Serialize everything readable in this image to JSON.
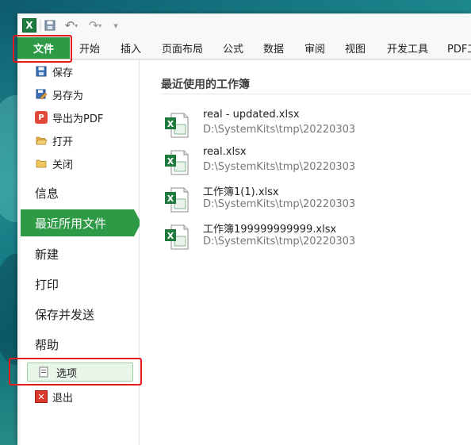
{
  "qat": {
    "app_icon_text": "X",
    "icons": [
      "excel-logo-icon",
      "save-icon",
      "undo-icon",
      "redo-icon",
      "customize-icon"
    ]
  },
  "ribbon": {
    "file_tab": "文件",
    "tabs": [
      "开始",
      "插入",
      "页面布局",
      "公式",
      "数据",
      "审阅",
      "视图",
      "开发工具",
      "PDF工具"
    ]
  },
  "backstage": {
    "commands": [
      {
        "label": "保存",
        "icon": "save-icon"
      },
      {
        "label": "另存为",
        "icon": "save-as-icon"
      },
      {
        "label": "导出为PDF",
        "icon": "pdf-icon"
      },
      {
        "label": "打开",
        "icon": "folder-open-icon"
      },
      {
        "label": "关闭",
        "icon": "folder-close-icon"
      }
    ],
    "nav": [
      "信息",
      "最近所用文件",
      "新建",
      "打印",
      "保存并发送",
      "帮助"
    ],
    "active_nav": "最近所用文件",
    "options_label": "选项",
    "exit_label": "退出"
  },
  "recent": {
    "title": "最近使用的工作簿",
    "files": [
      {
        "name": "real - updated.xlsx",
        "path": "D:\\SystemKits\\tmp\\20220303"
      },
      {
        "name": "real.xlsx",
        "path": "D:\\SystemKits\\tmp\\20220303"
      },
      {
        "name": "工作簿1(1).xlsx",
        "path": "D:\\SystemKits\\tmp\\20220303"
      },
      {
        "name": "工作簿199999999999.xlsx",
        "path": "D:\\SystemKits\\tmp\\20220303"
      }
    ]
  },
  "colors": {
    "accent_green": "#2e9a46",
    "highlight_red": "#e31b1b",
    "file_icon_green": "#1f7a3e"
  }
}
